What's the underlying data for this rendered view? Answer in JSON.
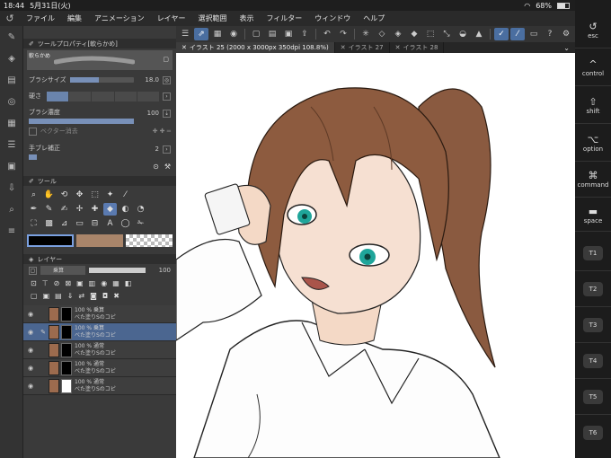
{
  "status": {
    "time": "18:44",
    "date": "5月31日(火)",
    "battery": "68%"
  },
  "menu": [
    "ファイル",
    "編集",
    "アニメーション",
    "レイヤー",
    "選択範囲",
    "表示",
    "フィルター",
    "ウィンドウ",
    "ヘルプ"
  ],
  "tabs": [
    {
      "label": "イラスト 25 (2000 x 3000px 350dpi 108.8%)"
    },
    {
      "label": "イラスト 27"
    },
    {
      "label": "イラスト 28"
    }
  ],
  "toolprop": {
    "title": "ツールプロパティ[軟らかめ]",
    "brush_name": "軟らかめ",
    "brush_size_label": "ブラシサイズ",
    "brush_size": "18.0",
    "brush_size_fill": 0.45,
    "hardness_label": "硬さ",
    "density_label": "ブラシ濃度",
    "density": "100",
    "vector_erase_label": "ベクター消去",
    "stabilize_label": "手ブレ補正",
    "stabilize": "2"
  },
  "tool_panel": {
    "title": "ツール"
  },
  "layer_panel": {
    "title": "レイヤー",
    "blend_mode": "乗算",
    "opacity": "100"
  },
  "layers": [
    {
      "percent": "100 %",
      "mode": "乗算",
      "name": "べた塗りSのコピ",
      "selected": false
    },
    {
      "percent": "100 %",
      "mode": "乗算",
      "name": "べた塗りSのコピ",
      "selected": true
    },
    {
      "percent": "100 %",
      "mode": "通常",
      "name": "べた塗りSのコピ",
      "selected": false
    },
    {
      "percent": "100 %",
      "mode": "通常",
      "name": "べた塗りSのコピ",
      "selected": false
    },
    {
      "percent": "100 %",
      "mode": "通常",
      "name": "べた塗りSのコピ",
      "selected": false
    }
  ],
  "keys": {
    "esc": "esc",
    "ctrl": "control",
    "shift": "shift",
    "option": "option",
    "command": "command",
    "space": "space",
    "t1": "T1",
    "t2": "T2",
    "t3": "T3",
    "t4": "T4",
    "t5": "T5",
    "t6": "T6"
  },
  "colors": {
    "main": "#000000",
    "sub": "#a9856a",
    "accent": "#4a6ea0"
  }
}
